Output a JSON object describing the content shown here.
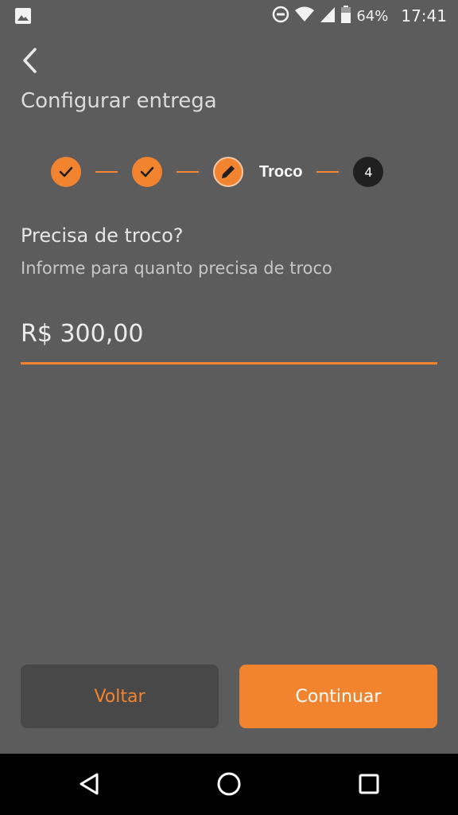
{
  "status_bar": {
    "battery": "64%",
    "time": "17:41",
    "icons": [
      "image-icon",
      "do-not-disturb-icon",
      "wifi-icon",
      "signal-icon",
      "battery-icon"
    ]
  },
  "header": {
    "title": "Configurar entrega"
  },
  "stepper": {
    "current_label": "Troco",
    "pending_number": "4"
  },
  "form": {
    "question": "Precisa de troco?",
    "helper": "Informe para quanto precisa de troco",
    "amount": "R$ 300,00"
  },
  "actions": {
    "back_label": "Voltar",
    "continue_label": "Continuar"
  },
  "colors": {
    "accent": "#f28430",
    "background": "#5c5c5c",
    "secondary_button": "#484848"
  }
}
